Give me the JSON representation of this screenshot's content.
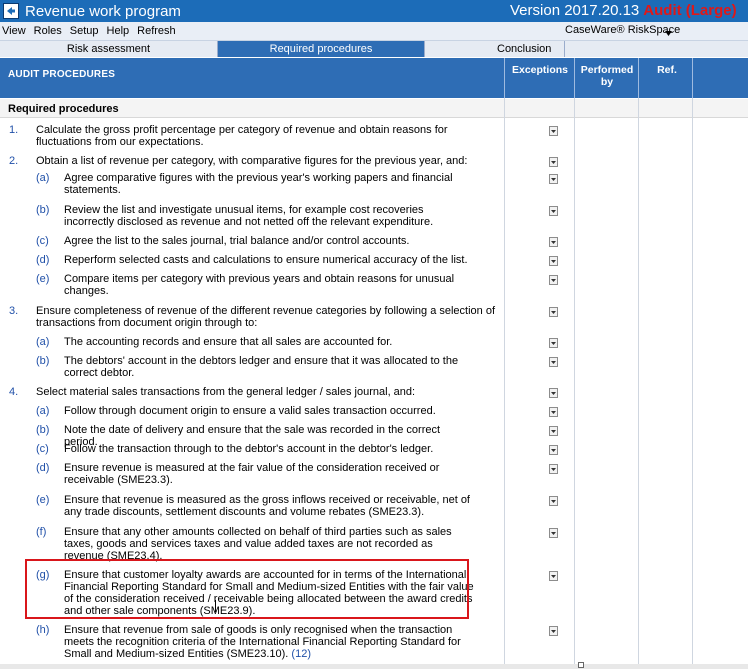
{
  "window": {
    "title": "Revenue work program",
    "version_label": "Version 2017.20.13",
    "audit_label": "Audit (Large)"
  },
  "menu": {
    "items": [
      "View",
      "Roles",
      "Setup",
      "Help",
      "Refresh"
    ],
    "riskspace": "CaseWare® RiskSpace"
  },
  "tabs": {
    "risk": "Risk assessment",
    "required": "Required procedures",
    "conclusion": "Conclusion"
  },
  "header": {
    "procedures": "AUDIT PROCEDURES",
    "exceptions": "Exceptions",
    "performed_by": "Performed by",
    "ref": "Ref."
  },
  "section_title": "Required procedures",
  "rows": [
    {
      "num": "1.",
      "text": "Calculate the gross profit percentage per category of revenue and obtain reasons for fluctuations from our expectations."
    },
    {
      "num": "2.",
      "text": "Obtain a list of revenue per category, with comparative figures for the previous year, and:"
    },
    {
      "num": "(a)",
      "text": "Agree comparative figures with the previous year's working papers and financial statements."
    },
    {
      "num": "(b)",
      "text": "Review the list and investigate unusual items, for example cost recoveries incorrectly disclosed as revenue and not netted off the relevant expenditure."
    },
    {
      "num": "(c)",
      "text": "Agree the list to the sales journal, trial balance and/or control accounts."
    },
    {
      "num": "(d)",
      "text": "Reperform selected casts and calculations to ensure numerical accuracy of the list."
    },
    {
      "num": "(e)",
      "text": "Compare items per category with previous years and obtain reasons for unusual changes."
    },
    {
      "num": "3.",
      "text": "Ensure completeness of revenue of the different revenue categories by following a selection of transactions from document origin through to:"
    },
    {
      "num": "(a)",
      "text": "The accounting records and ensure that all sales are accounted for."
    },
    {
      "num": "(b)",
      "text": "The debtors' account in the debtors ledger and ensure that it was allocated to the correct debtor."
    },
    {
      "num": "4.",
      "text": "Select material sales transactions from the general ledger / sales journal, and:"
    },
    {
      "num": "(a)",
      "text": "Follow through document origin to ensure a valid sales transaction occurred."
    },
    {
      "num": "(b)",
      "text": "Note the date of delivery and ensure that the sale was recorded in the correct period."
    },
    {
      "num": "(c)",
      "text": "Follow the transaction through to the debtor's account in the debtor's ledger."
    },
    {
      "num": "(d)",
      "text": "Ensure revenue is measured at the fair value of the consideration received or receivable (SME23.3)."
    },
    {
      "num": "(e)",
      "text": "Ensure that revenue is measured as the gross inflows received or receivable, net of any trade discounts, settlement discounts and volume rebates (SME23.3)."
    },
    {
      "num": "(f)",
      "text": "Ensure that any other amounts collected on behalf of third parties such as sales taxes, goods and services taxes and value added taxes are not recorded as revenue (SME23.4)."
    },
    {
      "num": "(g)",
      "text": "Ensure that customer loyalty awards are accounted for in terms of the International Financial Reporting Standard for Small and Medium-sized Entities with the fair value of the consideration received / receivable being allocated between the award credits and other sale components (SME23.9)."
    },
    {
      "num": "(h)",
      "text": "Ensure that revenue from sale of goods is only recognised when the transaction meets the recognition criteria of the International Financial Reporting Standard for Small and Medium-sized Entities (SME23.10).",
      "ref": "(12)"
    }
  ]
}
